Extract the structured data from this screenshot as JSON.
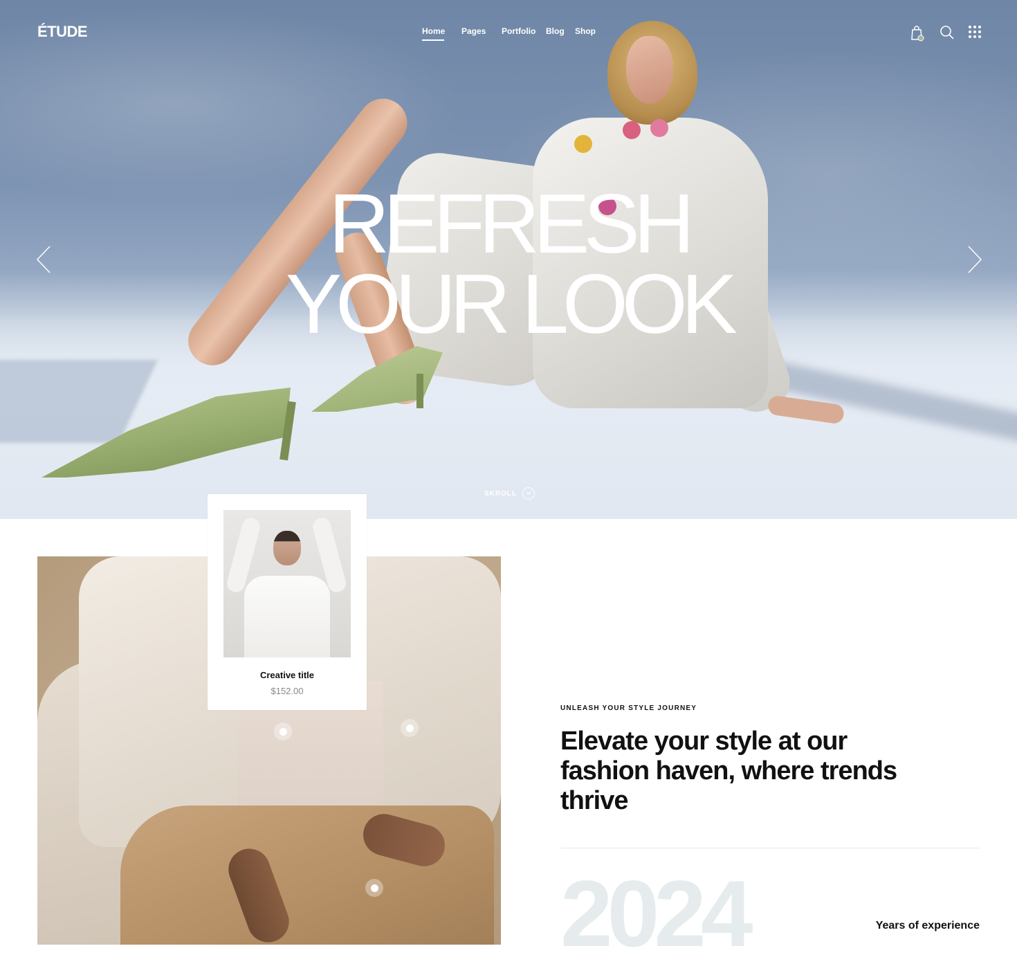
{
  "header": {
    "logo": "ÉTUDE",
    "nav": [
      {
        "label": "Home",
        "active": true
      },
      {
        "label": "Pages",
        "active": false
      },
      {
        "label": "Portfolio",
        "active": false
      },
      {
        "label": "Blog",
        "active": false
      },
      {
        "label": "Shop",
        "active": false
      }
    ],
    "icons": [
      "shopping-bag-icon",
      "search-icon",
      "grid-menu-icon"
    ]
  },
  "hero": {
    "title_line1": "REFRESH",
    "title_line2": "YOUR LOOK",
    "scroll_label": "SKROLL"
  },
  "product_card": {
    "title": "Creative title",
    "price": "$152.00"
  },
  "intro": {
    "eyebrow": "UNLEASH YOUR STYLE JOURNEY",
    "headline": "Elevate your style at our fashion haven, where trends thrive",
    "year": "2024",
    "years_label": "Years of experience"
  },
  "colors": {
    "accent_text": "#111111",
    "muted_text": "#888888",
    "year_watermark": "#e6eced",
    "hero_sky": "#7d93b2"
  }
}
